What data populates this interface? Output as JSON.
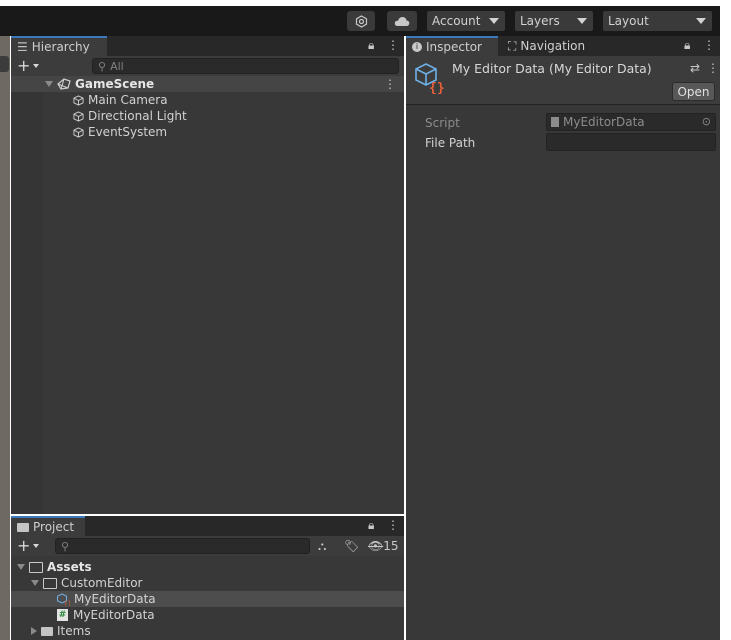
{
  "toolbar": {
    "account_label": "Account",
    "layers_label": "Layers",
    "layout_label": "Layout"
  },
  "hierarchy": {
    "tab_label": "Hierarchy",
    "search_placeholder": "All",
    "scene_name": "GameScene",
    "items": [
      "Main Camera",
      "Directional Light",
      "EventSystem"
    ]
  },
  "inspector": {
    "tab_label": "Inspector",
    "nav_tab_label": "Navigation",
    "object_title": "My Editor Data (My Editor Data)",
    "open_button": "Open",
    "script_label": "Script",
    "script_value": "MyEditorData",
    "file_path_label": "File Path",
    "file_path_value": ""
  },
  "project": {
    "tab_label": "Project",
    "hidden_count": "15",
    "tree": {
      "assets": "Assets",
      "custom_editor": "CustomEditor",
      "asset_item": "MyEditorData",
      "script_item": "MyEditorData",
      "items_folder": "Items"
    }
  },
  "colors": {
    "toolbar_bg": "#191919",
    "panel_bg": "#383838",
    "tab_active_accent": "#3a79bb",
    "selection_bg": "#4d4d4d"
  }
}
